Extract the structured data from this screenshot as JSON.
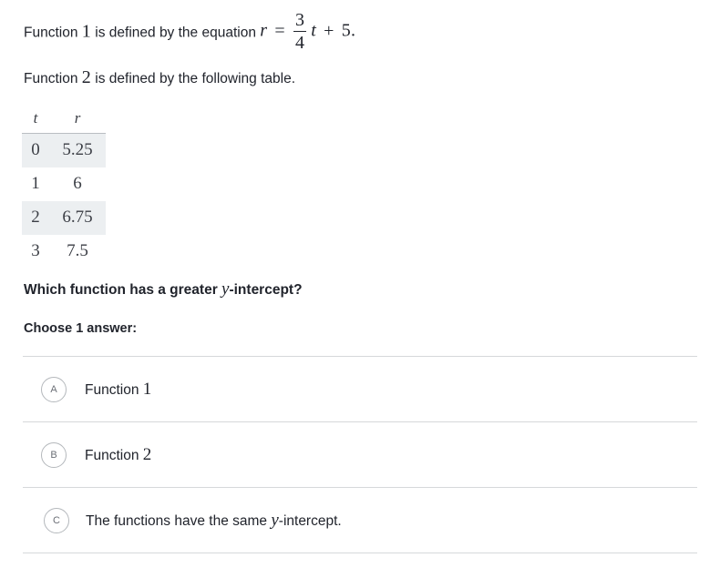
{
  "problem": {
    "function1_statement": {
      "prefix": "Function",
      "number": "1",
      "middle": "is defined by the equation",
      "equation": {
        "lhs_variable": "r",
        "equals": "=",
        "fraction_numerator": "3",
        "fraction_denominator": "4",
        "slope_variable": "t",
        "plus": "+",
        "intercept": "5",
        "period": "."
      }
    },
    "function2_statement": {
      "prefix": "Function",
      "number": "2",
      "suffix": "is defined by the following table."
    }
  },
  "table": {
    "headers": [
      "t",
      "r"
    ],
    "rows": [
      {
        "t": "0",
        "r": "5.25",
        "shaded": true
      },
      {
        "t": "1",
        "r": "6",
        "shaded": false
      },
      {
        "t": "2",
        "r": "6.75",
        "shaded": true
      },
      {
        "t": "3",
        "r": "7.5",
        "shaded": false
      }
    ]
  },
  "question": {
    "text_before_variable": "Which function has a greater ",
    "variable": "y",
    "text_after_variable": "-intercept?",
    "choose_label": "Choose 1 answer:"
  },
  "options": [
    {
      "badge": "A",
      "label_prefix": "Function ",
      "label_number": "1",
      "label_suffix": ""
    },
    {
      "badge": "B",
      "label_prefix": "Function ",
      "label_number": "2",
      "label_suffix": ""
    },
    {
      "badge": "C",
      "label_prefix": "The functions have the same ",
      "label_variable": "y",
      "label_suffix": "-intercept."
    }
  ],
  "colors": {
    "text": "#21242c",
    "table_shade": "#eceff1",
    "divider": "#d6d8da",
    "badge_border": "#b4b8bc"
  }
}
